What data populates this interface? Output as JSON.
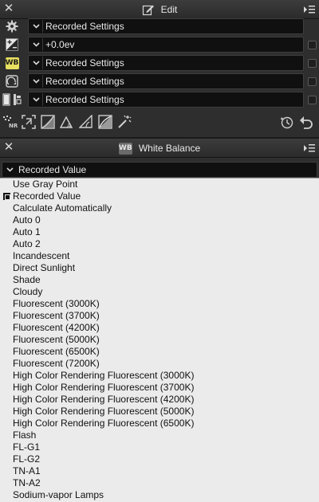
{
  "edit_panel": {
    "title": "Edit",
    "rows": [
      {
        "icon": "gear-icon",
        "value": "Recorded Settings"
      },
      {
        "icon": "exposure-icon",
        "value": "+0.0ev"
      },
      {
        "icon": "white-balance-icon",
        "icon_text": "WB",
        "value": "Recorded Settings"
      },
      {
        "icon": "picture-control-icon",
        "value": "Recorded Settings"
      },
      {
        "icon": "d-lighting-icon",
        "value": "Recorded Settings"
      }
    ],
    "tools": [
      "noise-reduction-icon",
      "crop-icon",
      "levels-curves-icon",
      "auto-levels-icon",
      "straighten-icon",
      "lch-icon",
      "retouch-brush-icon",
      "history-icon",
      "undo-icon"
    ],
    "tool_nr_text": "NR"
  },
  "wb_panel": {
    "title": "White Balance",
    "icon_text": "WB",
    "selected": "Recorded Value",
    "options": [
      "Use Gray Point",
      "Recorded Value",
      "Calculate Automatically",
      "Auto 0",
      "Auto 1",
      "Auto 2",
      "Incandescent",
      "Direct Sunlight",
      "Shade",
      "Cloudy",
      "Fluorescent (3000K)",
      "Fluorescent (3700K)",
      "Fluorescent (4200K)",
      "Fluorescent (5000K)",
      "Fluorescent (6500K)",
      "Fluorescent (7200K)",
      "High Color Rendering Fluorescent (3000K)",
      "High Color Rendering Fluorescent (3700K)",
      "High Color Rendering Fluorescent (4200K)",
      "High Color Rendering Fluorescent (5000K)",
      "High Color Rendering Fluorescent (6500K)",
      "Flash",
      "FL-G1",
      "FL-G2",
      "TN-A1",
      "TN-A2",
      "Sodium-vapor Lamps"
    ]
  },
  "colors": {
    "panel_bg": "#2e2e2e",
    "field_bg": "#101010",
    "list_bg": "#ebebeb",
    "wb_icon_bg": "#e8e060"
  }
}
